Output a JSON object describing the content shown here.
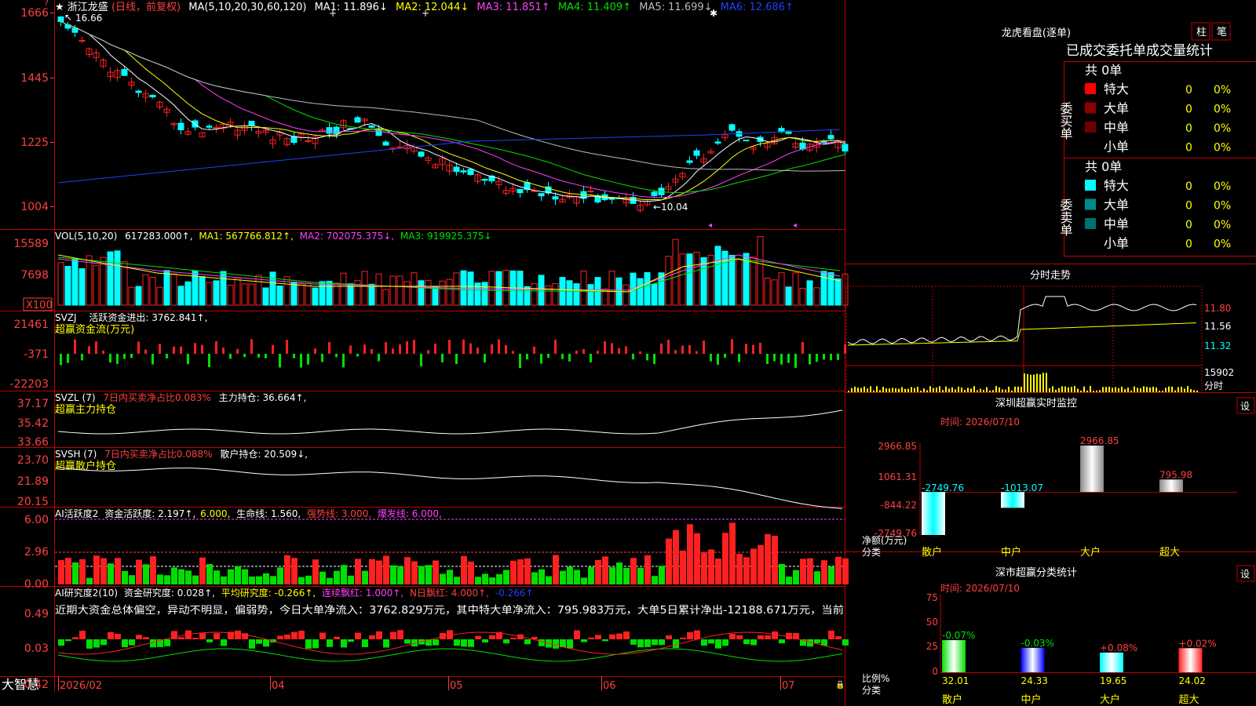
{
  "colors": {
    "up": "#ff2020",
    "down": "#00ffff",
    "frame": "#c00000",
    "axis": "#ff4040",
    "white": "#ffffff",
    "yellow": "#ffff00",
    "magenta": "#ff40ff",
    "green": "#00e000",
    "blue": "#2040ff",
    "gray": "#bbbbbb"
  },
  "kline": {
    "star": "★",
    "name": "浙江龙盛",
    "mode": "(日线，前复权)",
    "ma_title": "MA(5,10,20,30,60,120)",
    "ma": [
      {
        "label": "MA1: 11.896↓",
        "color": "#ffffff"
      },
      {
        "label": "MA2: 12.044↓",
        "color": "#ffff00"
      },
      {
        "label": "MA3: 11.851↑",
        "color": "#ff40ff"
      },
      {
        "label": "MA4: 11.409↑",
        "color": "#00e000"
      },
      {
        "label": "MA5: 11.699↓",
        "color": "#bbbbbb"
      },
      {
        "label": "MA6: 12.686↑",
        "color": "#2040ff"
      }
    ],
    "y_ticks": [
      "1666",
      "1445",
      "1225",
      "1004"
    ],
    "high_label": "16.66",
    "low_label": "←10.04"
  },
  "volume": {
    "title": "VOL(5,10,20)",
    "value": "617283.000↑,",
    "ma1": "MA1: 567766.812↑,",
    "ma2": "MA2: 702075.375↓,",
    "ma3": "MA3: 919925.375↓",
    "y_ticks": [
      "15589",
      "7698"
    ],
    "unit": "X100"
  },
  "svzj": {
    "title": "SVZJ",
    "label": "活跃资金进出: 3762.841↑,",
    "subtitle": "超赢资金流(万元)",
    "y_ticks": [
      "21461",
      "-371",
      "-22203"
    ]
  },
  "svzl": {
    "title": "SVZL (7)",
    "ratio": "7日内买卖净占比0.083%",
    "label": "主力持仓: 36.664↑,",
    "subtitle": "超赢主力持仓",
    "y_ticks": [
      "37.17",
      "35.42",
      "33.66"
    ]
  },
  "svsh": {
    "title": "SVSH (7)",
    "ratio": "7日内买卖净占比0.088%",
    "label": "散户持仓: 20.509↓,",
    "subtitle": "超赢散户持仓",
    "y_ticks": [
      "23.70",
      "21.89",
      "20.15"
    ]
  },
  "ai_active": {
    "title": "AI活跃度2",
    "label": "资金活跃度: 2.197↑,",
    "val2": "6.000,",
    "life": "生命线: 1.560,",
    "strong": "强势线: 3.000,",
    "burst": "爆发线: 6.000,",
    "y_ticks": [
      "6.00",
      "2.96",
      "0.00"
    ]
  },
  "ai_research": {
    "title": "AI研究度2(10)",
    "label": "资金研究度: 0.028↑,",
    "avg": "平均研究度: -0.266↑,",
    "red": "连续飘红: 1.000↑,",
    "nred": "N日飘红: 4.000↑,",
    "last": "-0.266↑",
    "comment": "近期大资金总体偏空，异动不明显，偏弱势，今日大单净流入：3762.829万元，其中特大单净流入：795.983万元，大单5日累计净出-12188.671万元，当前",
    "y_ticks": [
      "0.49",
      "0.03",
      "-0.42"
    ]
  },
  "x_axis": {
    "brand": "大智慧",
    "labels": [
      "2026/02",
      "04",
      "05",
      "06",
      "07"
    ]
  },
  "dragon": {
    "title": "龙虎看盘(逐单)",
    "btn1": "柱",
    "btn2": "笔",
    "stats_title": "已成交委托单成交量统计",
    "buy_label": "委买单",
    "sell_label": "委卖单",
    "buy_total": "共 0单",
    "sell_total": "共 0单",
    "buy_rows": [
      {
        "name": "特大",
        "count": "0",
        "pct": "0%",
        "color": "#ff0000"
      },
      {
        "name": "大单",
        "count": "0",
        "pct": "0%",
        "color": "#8b0000"
      },
      {
        "name": "中单",
        "count": "0",
        "pct": "0%",
        "color": "#700000"
      },
      {
        "name": "小单",
        "count": "0",
        "pct": "0%",
        "color": ""
      }
    ],
    "sell_rows": [
      {
        "name": "特大",
        "count": "0",
        "pct": "0%",
        "color": "#00ffff"
      },
      {
        "name": "大单",
        "count": "0",
        "pct": "0%",
        "color": "#008b8b"
      },
      {
        "name": "中单",
        "count": "0",
        "pct": "0%",
        "color": "#007070"
      },
      {
        "name": "小单",
        "count": "0",
        "pct": "0%",
        "color": ""
      }
    ]
  },
  "intraday": {
    "title": "分时走势",
    "prices": [
      "11.80",
      "11.56",
      "11.32"
    ],
    "vol": "15902",
    "unit": "分时"
  },
  "monitor": {
    "title": "深圳超赢实时监控",
    "setting": "设",
    "time": "时间: 2026/07/10",
    "y_ticks": [
      "2966.85",
      "1061.31",
      "-844.22",
      "-2749.76"
    ],
    "ylabel": "净额(万元)",
    "xlabel": "分类"
  },
  "classify": {
    "title": "深市超赢分类统计",
    "setting": "设",
    "time": "时间: 2026/07/10",
    "y_ticks": [
      "75",
      "50",
      "25",
      "0"
    ],
    "ylabel": "比例%",
    "xlabel": "分类"
  },
  "chart_data": [
    {
      "type": "bar",
      "title": "深圳超赢实时监控",
      "ylabel": "净额(万元)",
      "xlabel": "分类",
      "categories": [
        "散户",
        "中户",
        "大户",
        "超大"
      ],
      "values": [
        -2749.76,
        -1013.07,
        2966.85,
        795.98
      ],
      "value_labels": [
        "-2749.76",
        "-1013.07",
        "2966.85",
        "795.98"
      ],
      "ylim": [
        -2749.76,
        2966.85
      ]
    },
    {
      "type": "bar",
      "title": "深市超赢分类统计",
      "ylabel": "比例%",
      "xlabel": "分类",
      "categories": [
        "散户",
        "中户",
        "大户",
        "超大"
      ],
      "values": [
        32.01,
        24.33,
        19.65,
        24.02
      ],
      "change_labels": [
        "-0.07%",
        "-0.03%",
        "+0.08%",
        "+0.02%"
      ],
      "value_labels": [
        "32.01",
        "24.33",
        "19.65",
        "24.02"
      ],
      "ylim": [
        0,
        75
      ]
    }
  ]
}
